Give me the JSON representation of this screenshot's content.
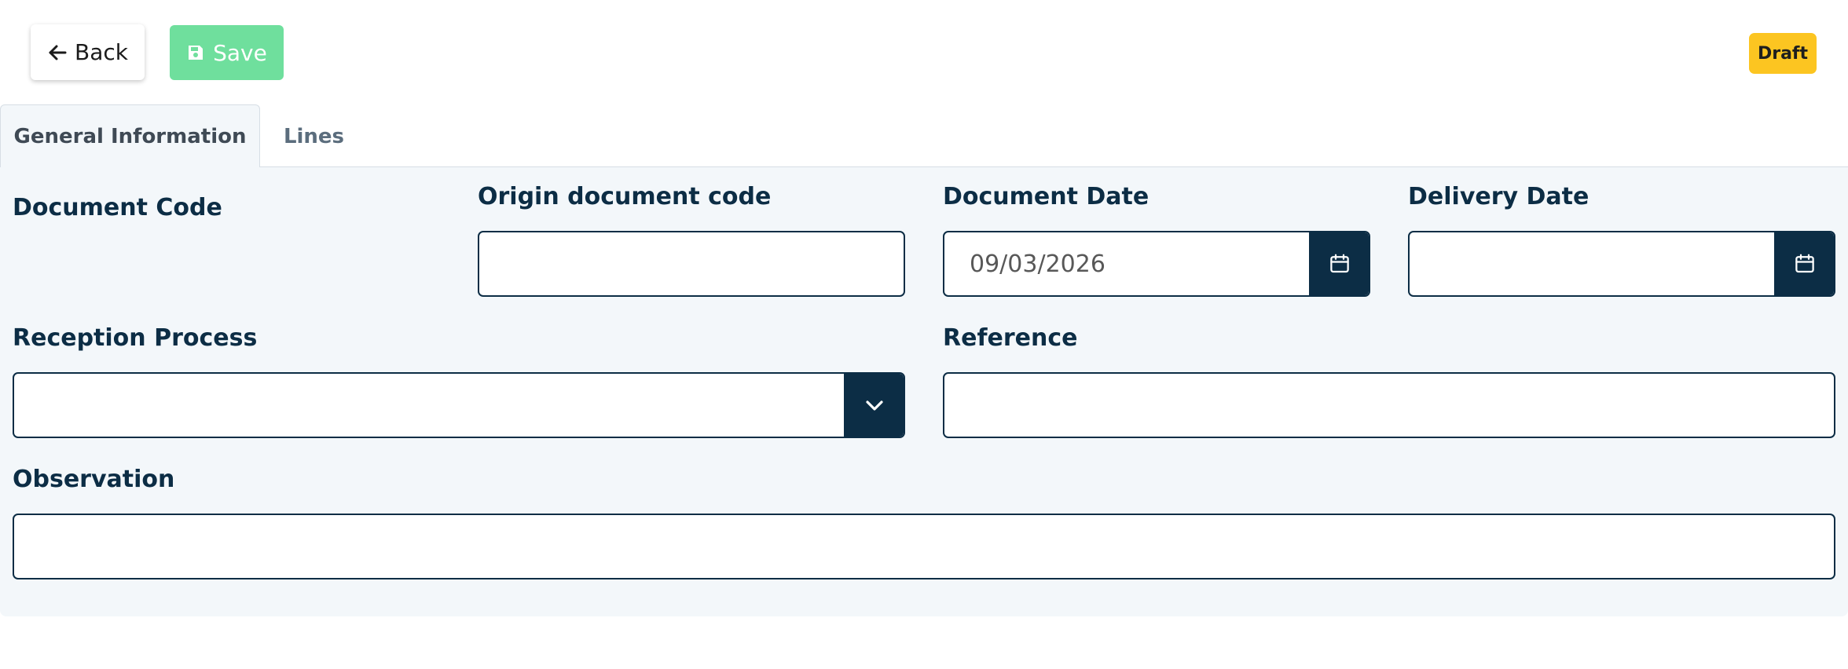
{
  "toolbar": {
    "back_label": "Back",
    "save_label": "Save",
    "status_badge": "Draft"
  },
  "tabs": [
    {
      "label": "General Information",
      "active": true
    },
    {
      "label": "Lines",
      "active": false
    }
  ],
  "form": {
    "document_code": {
      "label": "Document Code"
    },
    "origin_document_code": {
      "label": "Origin document code",
      "value": ""
    },
    "document_date": {
      "label": "Document Date",
      "value": "09/03/2026"
    },
    "delivery_date": {
      "label": "Delivery Date",
      "value": ""
    },
    "reception_process": {
      "label": "Reception Process",
      "value": ""
    },
    "reference": {
      "label": "Reference",
      "value": ""
    },
    "observation": {
      "label": "Observation",
      "value": ""
    }
  },
  "colors": {
    "primary": "#0c2d45",
    "save_button": "#6fdf9d",
    "draft_badge": "#fcc521",
    "panel_background": "#f3f7fa"
  },
  "icons": {
    "back": "arrow-left-icon",
    "save": "floppy-disk-icon",
    "date_picker": "calendar-icon",
    "select": "chevron-down-icon"
  }
}
